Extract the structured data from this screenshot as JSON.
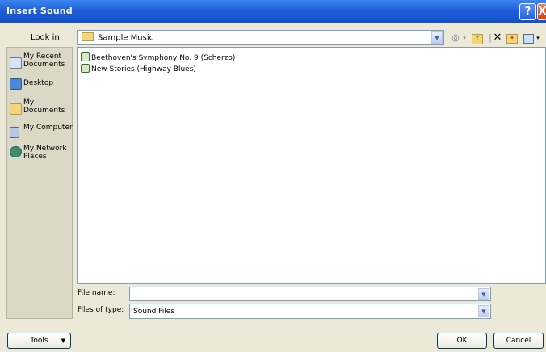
{
  "window": {
    "title": "Insert Sound",
    "help_glyph": "?",
    "close_glyph": "X"
  },
  "lookin": {
    "label": "Look in:",
    "value": "Sample Music"
  },
  "toolbar": {
    "back_icon": "back-arrow-icon",
    "up_icon": "up-folder-icon",
    "delete_icon": "delete-icon",
    "new_folder_icon": "new-folder-icon",
    "views_icon": "views-icon"
  },
  "places": [
    {
      "label": "My Recent Documents",
      "icon": "recent-documents-icon"
    },
    {
      "label": "Desktop",
      "icon": "desktop-icon"
    },
    {
      "label": "My Documents",
      "icon": "my-documents-icon"
    },
    {
      "label": "My Computer",
      "icon": "my-computer-icon"
    },
    {
      "label": "My Network Places",
      "icon": "network-places-icon"
    }
  ],
  "files": [
    {
      "name": "Beethoven's Symphony No. 9 (Scherzo)",
      "icon": "audio-file-icon"
    },
    {
      "name": "New Stories (Highway Blues)",
      "icon": "audio-file-icon"
    }
  ],
  "filename": {
    "label": "File name:",
    "value": ""
  },
  "filetype": {
    "label": "Files of type:",
    "value": "Sound Files"
  },
  "buttons": {
    "tools": "Tools",
    "ok": "OK",
    "cancel": "Cancel"
  },
  "colors": {
    "titlebar": "#1f5fd8",
    "dialog_bg": "#ece9d8",
    "border": "#7f9db9"
  }
}
